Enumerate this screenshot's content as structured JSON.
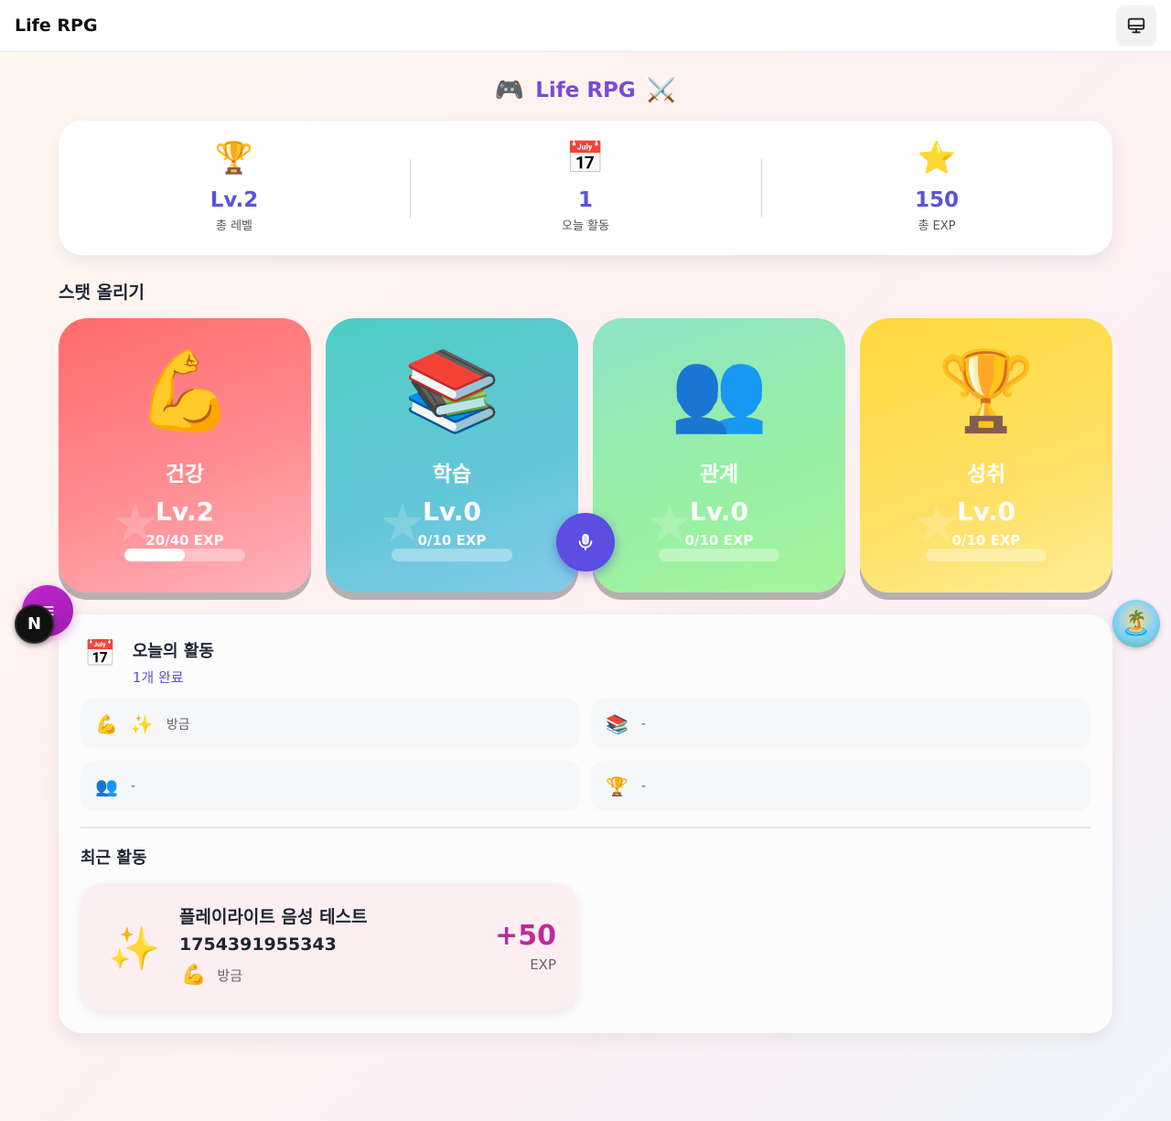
{
  "topbar": {
    "title": "Life RPG",
    "monitor_icon": "monitor-icon"
  },
  "hero": {
    "left_emoji": "🎮",
    "title": "Life RPG",
    "right_emoji": "⚔️"
  },
  "summary": [
    {
      "icon": "🏆",
      "value": "Lv.2",
      "label": "총 레벨"
    },
    {
      "icon": "📅",
      "value": "1",
      "label": "오늘 활동"
    },
    {
      "icon": "⭐",
      "value": "150",
      "label": "총 EXP"
    }
  ],
  "stats_section": {
    "title": "스탯 올리기"
  },
  "stats": [
    {
      "icon": "💪",
      "name": "건강",
      "level": "Lv.2",
      "exp": "20/40 EXP",
      "progress": 0.5,
      "color": "#ff6b6b"
    },
    {
      "icon": "📚",
      "name": "학습",
      "level": "Lv.0",
      "exp": "0/10 EXP",
      "progress": 0,
      "color": "#4ecdc4"
    },
    {
      "icon": "👥",
      "name": "관계",
      "level": "Lv.0",
      "exp": "0/10 EXP",
      "progress": 0,
      "color": "#95e1a0"
    },
    {
      "icon": "🏆",
      "name": "성취",
      "level": "Lv.0",
      "exp": "0/10 EXP",
      "progress": 0,
      "color": "#ffd93d"
    }
  ],
  "today": {
    "icon": "📅",
    "title": "오늘의 활동",
    "subtitle": "1개 완료",
    "items": [
      {
        "icon": "💪",
        "extra_icon": "✨",
        "text": "방금"
      },
      {
        "icon": "📚",
        "extra_icon": "",
        "text": "-"
      },
      {
        "icon": "👥",
        "extra_icon": "",
        "text": "-"
      },
      {
        "icon": "🏆",
        "extra_icon": "",
        "text": "-"
      }
    ]
  },
  "recent": {
    "title": "최근 활동",
    "items": [
      {
        "icon": "✨",
        "title": "플레이라이트 음성 테스트 1754391955343",
        "stat_icon": "💪",
        "time": "방금",
        "exp": "+50",
        "exp_unit": "EXP"
      }
    ]
  },
  "floating": {
    "next_badge": "N",
    "island_icon": "🏝️"
  },
  "colors": {
    "accent": "#5b54d8",
    "mic": "#5b4ee0",
    "menu_fab": "#c026d3",
    "exp_value": "#c02a9a"
  }
}
